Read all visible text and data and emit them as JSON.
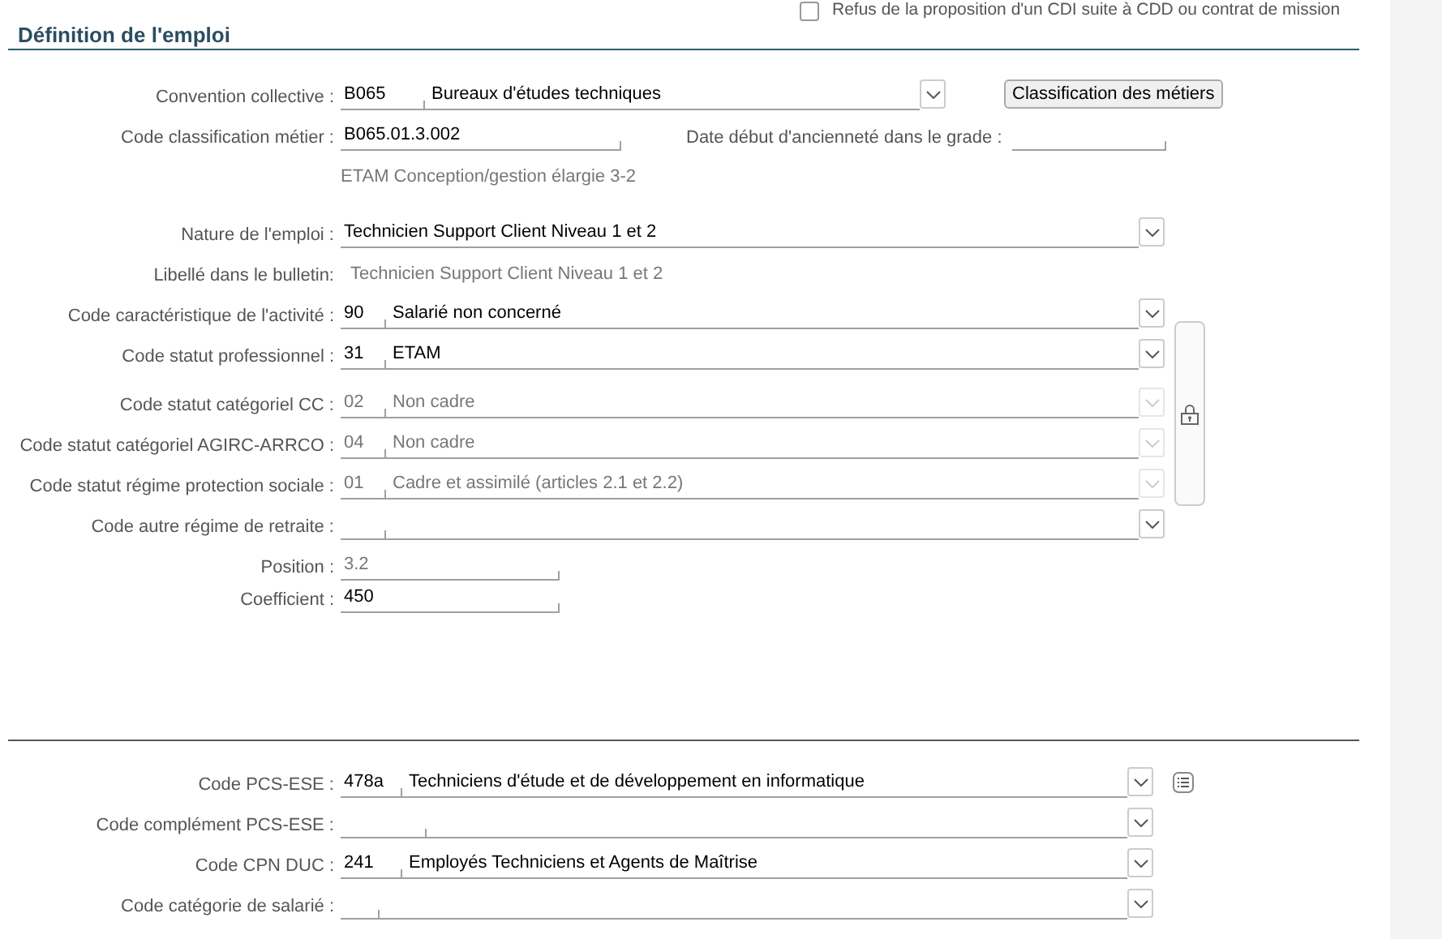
{
  "header_checkbox": {
    "label": "Refus de la proposition d'un CDI suite à CDD ou contrat de mission",
    "checked": false
  },
  "section_title": "Définition de l'emploi",
  "convention": {
    "label": "Convention collective :",
    "code": "B065",
    "value": "Bureaux d'études techniques",
    "button": "Classification des métiers"
  },
  "classification": {
    "label": "Code classification métier :",
    "value": "B065.01.3.002",
    "date_label": "Date début d'ancienneté dans le grade :",
    "note": "ETAM Conception/gestion élargie 3-2"
  },
  "job_rows": [
    {
      "kind": "select",
      "label": "Nature de l'emploi :",
      "value": "Technicien Support Client Niveau 1 et 2"
    },
    {
      "kind": "text",
      "label": "Libellé dans le bulletin:",
      "value": "Technicien Support Client Niveau 1 et 2"
    },
    {
      "kind": "coded",
      "label": "Code caractéristique de l'activité :",
      "code": "90",
      "value": "Salarié non concerné",
      "disabled": false
    },
    {
      "kind": "group",
      "rows": [
        {
          "label": "Code statut professionnel :",
          "code": "31",
          "value": "ETAM",
          "disabled": false
        },
        {
          "label": "Code statut catégoriel CC :",
          "code": "02",
          "value": "Non cadre",
          "disabled": true
        },
        {
          "label": "Code statut catégoriel AGIRC-ARRCO :",
          "code": "04",
          "value": "Non cadre",
          "disabled": true
        },
        {
          "label": "Code statut régime protection sociale :",
          "code": "01",
          "value": "Cadre et assimilé (articles 2.1 et 2.2)",
          "disabled": true
        }
      ]
    },
    {
      "kind": "coded",
      "label": "Code autre régime de retraite :",
      "disabled": false
    }
  ],
  "levels": [
    {
      "label": "Position :",
      "value": "3.2",
      "disabled": true
    },
    {
      "label": "Coefficient :",
      "value": "450",
      "disabled": false
    }
  ],
  "dsn_rows": [
    {
      "kind": "list",
      "label": "Code PCS-ESE :",
      "code": "478a",
      "value": "Techniciens d'étude et de développement en informatique"
    },
    {
      "kind": "plain",
      "label": "Code complément PCS-ESE :"
    },
    {
      "kind": "plain",
      "label": "Code CPN DUC :",
      "code": "241",
      "value": "Employés Techniciens et Agents de Maîtrise"
    },
    {
      "kind": "plain",
      "label": "Code catégorie de salarié :"
    }
  ]
}
